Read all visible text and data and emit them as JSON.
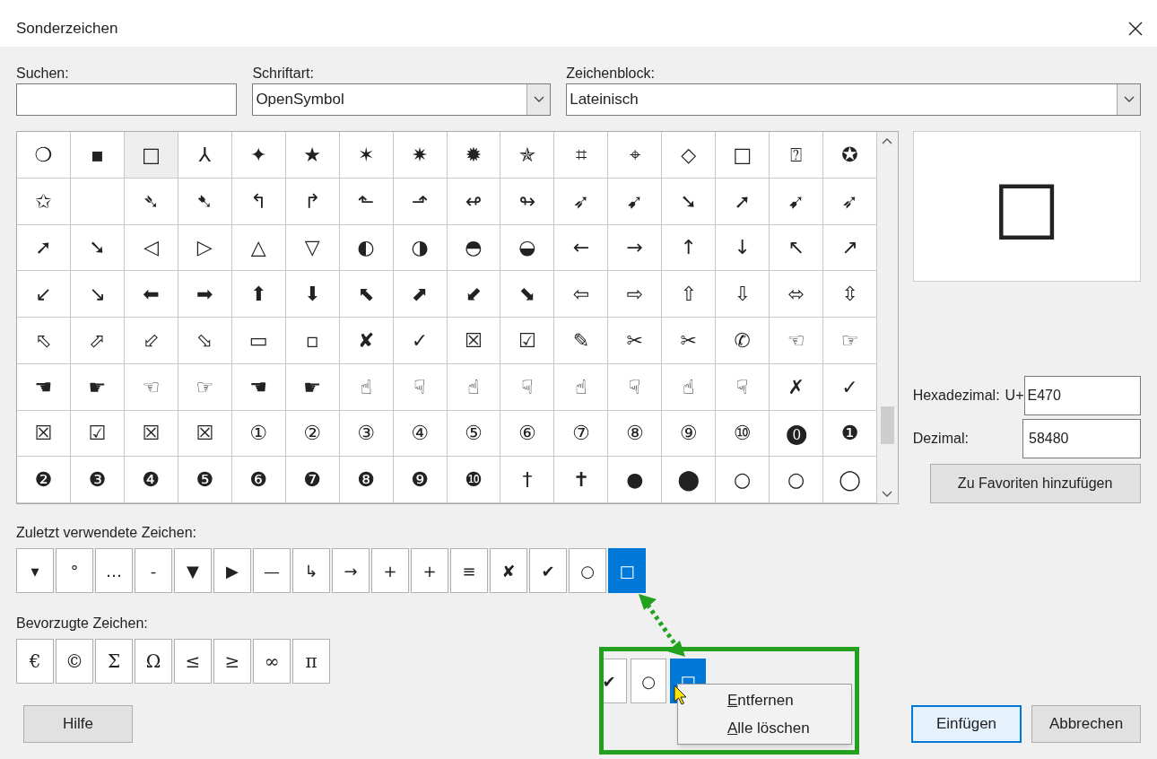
{
  "window": {
    "title": "Sonderzeichen"
  },
  "search": {
    "label": "Suchen:"
  },
  "font": {
    "label": "Schriftart:",
    "value": "OpenSymbol"
  },
  "block": {
    "label": "Zeichenblock:",
    "value": "Lateinisch"
  },
  "grid": {
    "cells": [
      {
        "c": "❍",
        "selected": false
      },
      {
        "c": "▪",
        "selected": false
      },
      {
        "c": "□",
        "selected": true
      },
      {
        "c": "⅄",
        "selected": false
      },
      {
        "c": "✦",
        "selected": false
      },
      {
        "c": "★",
        "selected": false
      },
      {
        "c": "✶",
        "selected": false
      },
      {
        "c": "✷",
        "selected": false
      },
      {
        "c": "✹",
        "selected": false
      },
      {
        "c": "✯",
        "selected": false
      },
      {
        "c": "⌗",
        "selected": false
      },
      {
        "c": "⌖",
        "selected": false
      },
      {
        "c": "◇",
        "selected": false
      },
      {
        "c": "□",
        "selected": false
      },
      {
        "c": "⍰",
        "selected": false
      },
      {
        "c": "✪",
        "selected": false
      },
      {
        "c": "✩",
        "selected": false
      },
      {
        "selected": false
      },
      {
        "c": "➴",
        "selected": false
      },
      {
        "c": "➷",
        "selected": false
      },
      {
        "c": "↰",
        "selected": false
      },
      {
        "c": "↱",
        "selected": false
      },
      {
        "c": "⬑",
        "selected": false
      },
      {
        "c": "⬏",
        "selected": false
      },
      {
        "c": "↫",
        "selected": false
      },
      {
        "c": "↬",
        "selected": false
      },
      {
        "c": "➶",
        "selected": false
      },
      {
        "c": "➹",
        "selected": false
      },
      {
        "c": "➘",
        "selected": false
      },
      {
        "c": "➚",
        "selected": false
      },
      {
        "c": "➹",
        "selected": false
      },
      {
        "c": "➶",
        "selected": false
      },
      {
        "c": "➚",
        "selected": false
      },
      {
        "c": "➘",
        "selected": false
      },
      {
        "c": "◁",
        "selected": false
      },
      {
        "c": "▷",
        "selected": false
      },
      {
        "c": "△",
        "selected": false
      },
      {
        "c": "▽",
        "selected": false
      },
      {
        "c": "◐",
        "selected": false
      },
      {
        "c": "◑",
        "selected": false
      },
      {
        "c": "◓",
        "selected": false
      },
      {
        "c": "◒",
        "selected": false
      },
      {
        "c": "←",
        "selected": false
      },
      {
        "c": "→",
        "selected": false
      },
      {
        "c": "↑",
        "selected": false
      },
      {
        "c": "↓",
        "selected": false
      },
      {
        "c": "↖",
        "selected": false
      },
      {
        "c": "↗",
        "selected": false
      },
      {
        "c": "↙",
        "selected": false
      },
      {
        "c": "↘",
        "selected": false
      },
      {
        "c": "⬅",
        "selected": false
      },
      {
        "c": "➡",
        "selected": false
      },
      {
        "c": "⬆",
        "selected": false
      },
      {
        "c": "⬇",
        "selected": false
      },
      {
        "c": "⬉",
        "selected": false
      },
      {
        "c": "⬈",
        "selected": false
      },
      {
        "c": "⬋",
        "selected": false
      },
      {
        "c": "⬊",
        "selected": false
      },
      {
        "c": "⇦",
        "selected": false
      },
      {
        "c": "⇨",
        "selected": false
      },
      {
        "c": "⇧",
        "selected": false
      },
      {
        "c": "⇩",
        "selected": false
      },
      {
        "c": "⬄",
        "selected": false
      },
      {
        "c": "⇳",
        "selected": false
      },
      {
        "c": "⬁",
        "selected": false
      },
      {
        "c": "⬀",
        "selected": false
      },
      {
        "c": "⬃",
        "selected": false
      },
      {
        "c": "⬂",
        "selected": false
      },
      {
        "c": "▭",
        "selected": false
      },
      {
        "c": "▫",
        "selected": false
      },
      {
        "c": "✘",
        "selected": false
      },
      {
        "c": "✓",
        "selected": false
      },
      {
        "c": "☒",
        "selected": false
      },
      {
        "c": "☑",
        "selected": false
      },
      {
        "c": "✎",
        "selected": false
      },
      {
        "c": "✂",
        "selected": false
      },
      {
        "c": "✂",
        "selected": false
      },
      {
        "c": "✆",
        "selected": false
      },
      {
        "c": "☜",
        "selected": false
      },
      {
        "c": "☞",
        "selected": false
      },
      {
        "c": "☚",
        "selected": false
      },
      {
        "c": "☛",
        "selected": false
      },
      {
        "c": "☜",
        "selected": false
      },
      {
        "c": "☞",
        "selected": false
      },
      {
        "c": "☚",
        "selected": false
      },
      {
        "c": "☛",
        "selected": false
      },
      {
        "c": "☝",
        "selected": false
      },
      {
        "c": "☟",
        "selected": false
      },
      {
        "c": "☝",
        "selected": false
      },
      {
        "c": "☟",
        "selected": false
      },
      {
        "c": "☝",
        "selected": false
      },
      {
        "c": "☟",
        "selected": false
      },
      {
        "c": "☝",
        "selected": false
      },
      {
        "c": "☟",
        "selected": false
      },
      {
        "c": "✗",
        "selected": false
      },
      {
        "c": "✓",
        "selected": false
      },
      {
        "c": "☒",
        "selected": false
      },
      {
        "c": "☑",
        "selected": false
      },
      {
        "c": "☒",
        "selected": false
      },
      {
        "c": "☒",
        "selected": false
      },
      {
        "c": "①",
        "selected": false
      },
      {
        "c": "②",
        "selected": false
      },
      {
        "c": "③",
        "selected": false
      },
      {
        "c": "④",
        "selected": false
      },
      {
        "c": "⑤",
        "selected": false
      },
      {
        "c": "⑥",
        "selected": false
      },
      {
        "c": "⑦",
        "selected": false
      },
      {
        "c": "⑧",
        "selected": false
      },
      {
        "c": "⑨",
        "selected": false
      },
      {
        "c": "⑩",
        "selected": false
      },
      {
        "c": "⓿",
        "selected": false
      },
      {
        "c": "❶",
        "selected": false
      },
      {
        "c": "❷",
        "selected": false
      },
      {
        "c": "❸",
        "selected": false
      },
      {
        "c": "❹",
        "selected": false
      },
      {
        "c": "❺",
        "selected": false
      },
      {
        "c": "❻",
        "selected": false
      },
      {
        "c": "❼",
        "selected": false
      },
      {
        "c": "❽",
        "selected": false
      },
      {
        "c": "❾",
        "selected": false
      },
      {
        "c": "❿",
        "selected": false
      },
      {
        "c": "†",
        "selected": false
      },
      {
        "c": "✝",
        "selected": false
      },
      {
        "c": "●",
        "selected": false
      },
      {
        "c": "⬤",
        "selected": false
      },
      {
        "c": "○",
        "selected": false
      },
      {
        "c": "○",
        "selected": false
      },
      {
        "c": "◯",
        "selected": false
      }
    ]
  },
  "preview": {
    "char": "□"
  },
  "hex": {
    "label": "Hexadezimal:",
    "prefix": "U+",
    "value": "E470"
  },
  "decimal": {
    "label": "Dezimal:",
    "value": "58480"
  },
  "add_favorite_button": "Zu Favoriten hinzufügen",
  "recent": {
    "label": "Zuletzt verwendete Zeichen:",
    "chars": [
      {
        "c": "▾",
        "selected": false
      },
      {
        "c": "°",
        "selected": false
      },
      {
        "c": "…",
        "selected": false
      },
      {
        "c": "-",
        "selected": false
      },
      {
        "c": "▼",
        "selected": false
      },
      {
        "c": "▶",
        "selected": false
      },
      {
        "c": "—",
        "selected": false
      },
      {
        "c": "↳",
        "selected": false
      },
      {
        "c": "→",
        "selected": false
      },
      {
        "c": "+",
        "selected": false
      },
      {
        "c": "+",
        "selected": false
      },
      {
        "c": "≡",
        "selected": false
      },
      {
        "c": "✘",
        "selected": false
      },
      {
        "c": "✔",
        "selected": false
      },
      {
        "c": "○",
        "selected": false
      },
      {
        "c": "□",
        "selected": true
      }
    ]
  },
  "favorites": {
    "label": "Bevorzugte Zeichen:",
    "chars": [
      "€",
      "©",
      "Σ",
      "Ω",
      "≤",
      "≥",
      "∞",
      "π"
    ]
  },
  "annotation": {
    "chars": [
      {
        "c": "✔",
        "selected": false
      },
      {
        "c": "○",
        "selected": false
      },
      {
        "c": "□",
        "selected": true
      }
    ],
    "menu": [
      "Entfernen",
      "Alle löschen"
    ]
  },
  "buttons": [
    {
      "label": "Hilfe",
      "default": false
    },
    {
      "label": "Einfügen",
      "default": true
    },
    {
      "label": "Abbrechen",
      "default": false
    }
  ]
}
